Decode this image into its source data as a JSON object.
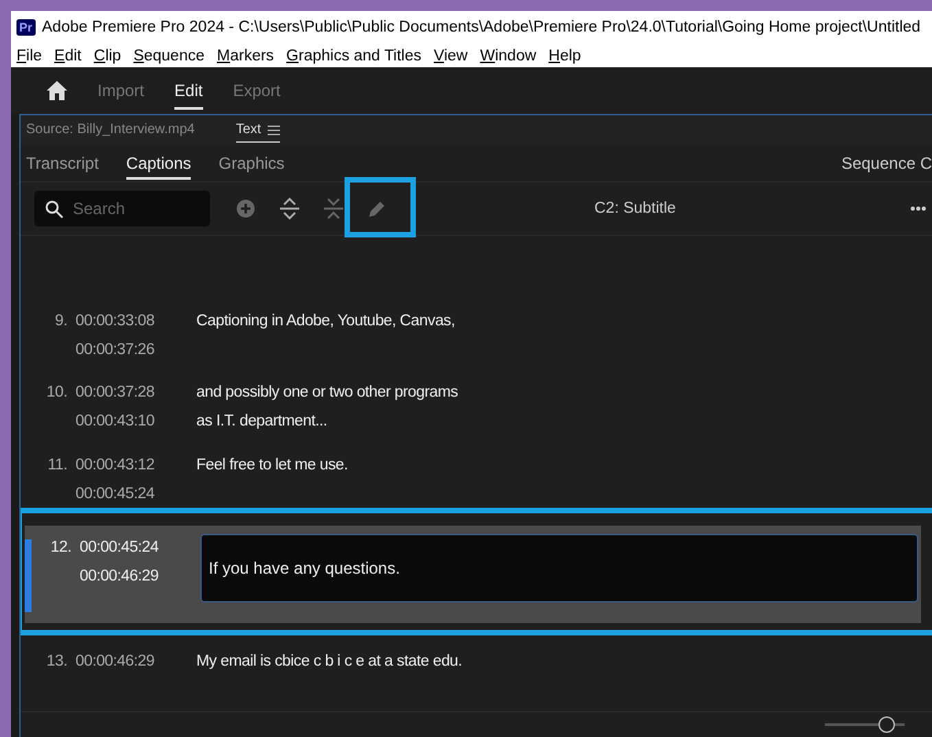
{
  "window": {
    "app_badge": "Pr",
    "title": "Adobe Premiere Pro 2024 - C:\\Users\\Public\\Public Documents\\Adobe\\Premiere Pro\\24.0\\Tutorial\\Going Home project\\Untitled"
  },
  "menu": [
    "File",
    "Edit",
    "Clip",
    "Sequence",
    "Markers",
    "Graphics and Titles",
    "View",
    "Window",
    "Help"
  ],
  "workspaces": [
    {
      "label": "Import",
      "selected": false
    },
    {
      "label": "Edit",
      "selected": true
    },
    {
      "label": "Export",
      "selected": false
    }
  ],
  "panel_tabs": [
    {
      "label": "Source: Billy_Interview.mp4",
      "selected": false
    },
    {
      "label": "Text",
      "selected": true
    }
  ],
  "sub_tabs": [
    {
      "label": "Transcript",
      "selected": false
    },
    {
      "label": "Captions",
      "selected": true
    },
    {
      "label": "Graphics",
      "selected": false
    }
  ],
  "sequence_label": "Sequence C",
  "toolbar": {
    "search": {
      "placeholder": "Search"
    },
    "tools": [
      {
        "kind": "add",
        "disabled": true,
        "highlighted": false
      },
      {
        "kind": "split",
        "disabled": false,
        "highlighted": false
      },
      {
        "kind": "merge",
        "disabled": true,
        "highlighted": false
      },
      {
        "kind": "edit",
        "disabled": true,
        "highlighted": true
      }
    ],
    "track": "C2: Subtitle"
  },
  "captions": [
    {
      "number": "9.",
      "start": "00:00:33:08",
      "end": "00:00:37:26",
      "text": "Captioning in Adobe, Youtube, Canvas,",
      "selected": false,
      "highlighted": false
    },
    {
      "number": "10.",
      "start": "00:00:37:28",
      "end": "00:00:43:10",
      "text": "and possibly one or two other programs\nas I.T. department...",
      "selected": false,
      "highlighted": false
    },
    {
      "number": "11.",
      "start": "00:00:43:12",
      "end": "00:00:45:24",
      "text": "Feel free to let me use.",
      "selected": false,
      "highlighted": false
    },
    {
      "number": "12.",
      "start": "00:00:45:24",
      "end": "00:00:46:29",
      "text": "If you have any questions.",
      "selected": true,
      "highlighted": true
    },
    {
      "number": "13.",
      "start": "00:00:46:29",
      "text": "My email is cbice c b i c e at a state edu.",
      "selected": false,
      "highlighted": false
    }
  ],
  "zoom_slider": {
    "level": 0.85
  }
}
